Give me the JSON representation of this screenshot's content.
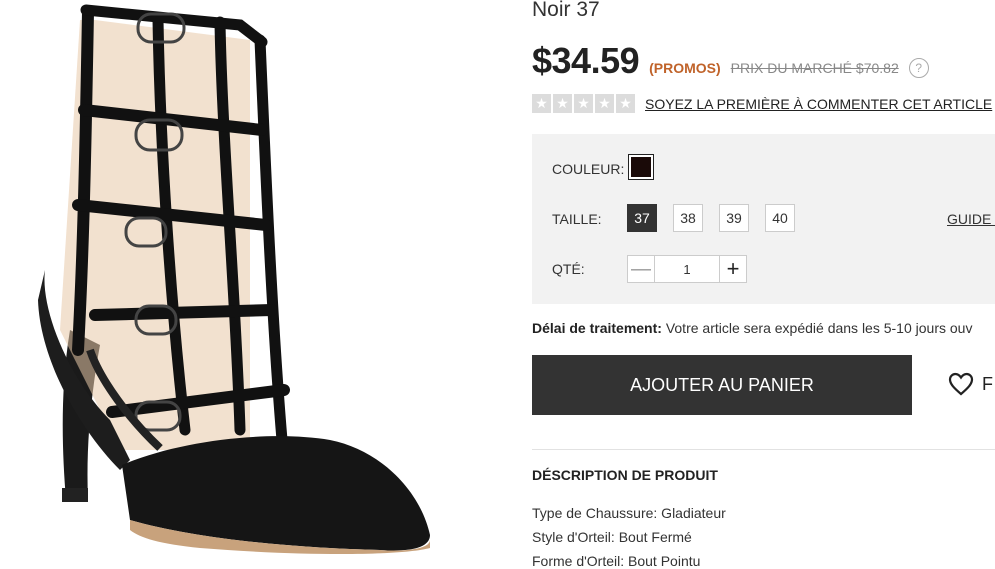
{
  "product": {
    "title": "Noir 37",
    "image_alt": "shoe-image"
  },
  "price": {
    "current": "$34.59",
    "promo_label": "(PROMOS)",
    "market_label": "PRIX DU MARCHÉ $70.82",
    "help_glyph": "?"
  },
  "rating": {
    "stars_filled": 0,
    "stars_total": 5,
    "review_link": "SOYEZ LA PREMIÈRE À COMMENTER CET ARTICLE"
  },
  "options": {
    "color_label": "COULEUR:",
    "selected_color": "#1a0a08",
    "size_label": "TAILLE:",
    "sizes": [
      "37",
      "38",
      "39",
      "40"
    ],
    "selected_size": "37",
    "size_guide": "GUIDE I",
    "qty_label": "QTÉ:",
    "qty_value": "1",
    "qty_minus": "—",
    "qty_plus": "+"
  },
  "processing": {
    "label": "Délai de traitement:",
    "text": " Votre article sera expédié dans les 5-10 jours ouv"
  },
  "cart": {
    "add_label": "AJOUTER AU PANIER",
    "favorite_label": "F",
    "favorite_icon": "heart-icon"
  },
  "description": {
    "title": "DÉSCRIPTION DE PRODUIT",
    "lines": [
      "Type de Chaussure: Gladiateur",
      "Style d'Orteil: Bout Fermé",
      "Forme d'Orteil: Bout Pointu"
    ]
  },
  "colors": {
    "button_dark": "#333333",
    "promo": "#c0632a",
    "panel_bg": "#f2f2f2"
  }
}
